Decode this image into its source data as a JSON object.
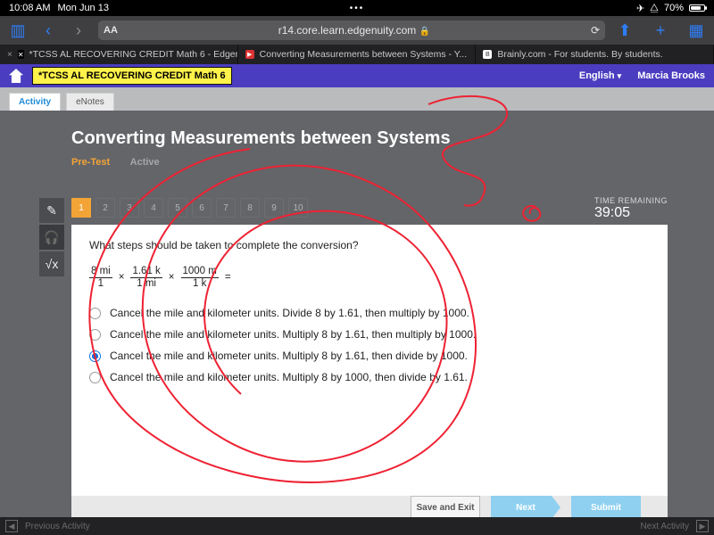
{
  "status": {
    "time": "10:08 AM",
    "date": "Mon Jun 13",
    "battery": "70%"
  },
  "browser": {
    "url": "r14.core.learn.edgenuity.com",
    "tabs": [
      {
        "close": "×",
        "fav": "✕",
        "label": "*TCSS AL RECOVERING CREDIT Math 6 - Edgen..."
      },
      {
        "fav": "▶",
        "label": "Converting Measurements between Systems - Y..."
      },
      {
        "fav": "B",
        "label": "Brainly.com - For students. By students."
      }
    ]
  },
  "edgenuity": {
    "crumb": "*TCSS AL RECOVERING CREDIT Math 6",
    "lang": "English",
    "user": "Marcia Brooks",
    "tabs": {
      "activity": "Activity",
      "enotes": "eNotes"
    }
  },
  "lesson": {
    "title": "Converting Measurements between Systems",
    "pretest": "Pre-Test",
    "active": "Active",
    "numbers": [
      "1",
      "2",
      "3",
      "4",
      "5",
      "6",
      "7",
      "8",
      "9",
      "10"
    ],
    "timer_label": "TIME REMAINING",
    "timer_value": "39:05"
  },
  "question": {
    "prompt": "What steps should be taken to complete the conversion?",
    "frac1n": "8 mi",
    "frac1d": "1",
    "frac2n": "1.61 k",
    "frac2d": "1 mi",
    "frac3n": "1000 m",
    "frac3d": "1 k",
    "eq": "=",
    "options": [
      "Cancel the mile and kilometer units. Divide 8 by 1.61, then multiply by 1000.",
      "Cancel the mile and kilometer units. Multiply 8 by 1.61, then multiply by 1000.",
      "Cancel the mile and kilometer units. Multiply 8 by 1.61, then divide by 1000.",
      "Cancel the mile and kilometer units. Multiply 8 by 1000, then divide by 1.61."
    ],
    "selected_index": 2,
    "buttons": {
      "save": "Save and Exit",
      "next": "Next",
      "submit": "Submit"
    }
  },
  "bottom": {
    "prev": "Previous Activity",
    "next": "Next Activity"
  }
}
